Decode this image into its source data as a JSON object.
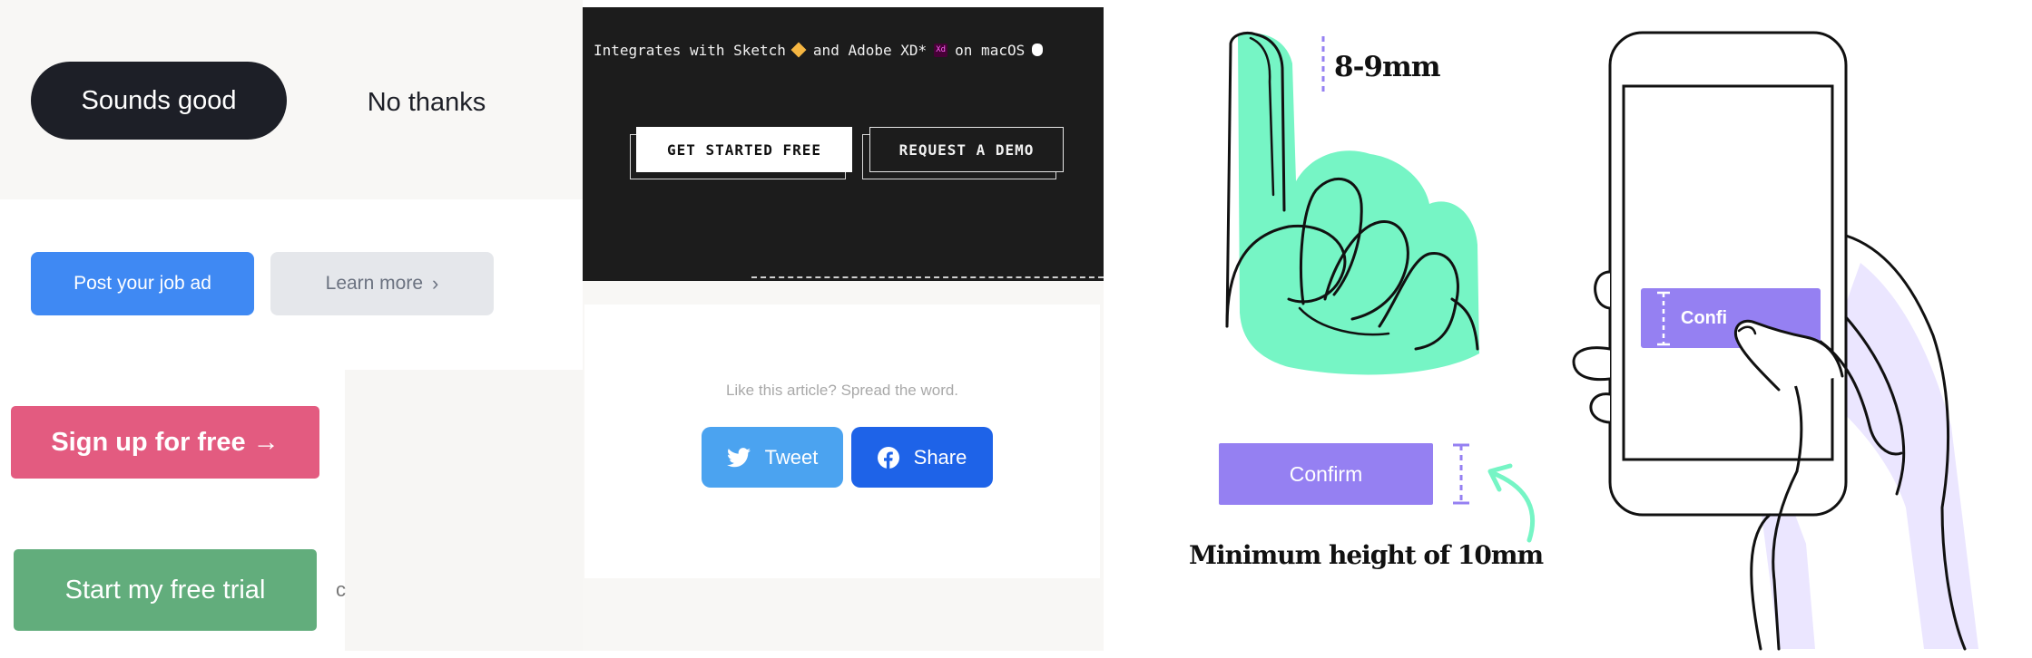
{
  "cta_sample_a": {
    "primary_label": "Sounds good",
    "secondary_label": "No thanks"
  },
  "cta_sample_b": {
    "primary_label": "Post your job ad",
    "secondary_label": "Learn more",
    "secondary_chevron": "›"
  },
  "cta_sample_c": {
    "signup_label": "Sign up for free →",
    "trial_label": "Start my free trial",
    "truncated_text": "c"
  },
  "cta_sample_d": {
    "integrates_before": "Integrates with Sketch",
    "integrates_mid": "and Adobe XD*",
    "xd_badge": "Xd",
    "integrates_after": "on macOS",
    "get_started_label": "GET STARTED FREE",
    "request_demo_label": "REQUEST A DEMO"
  },
  "cta_sample_e": {
    "spread_text": "Like this article? Spread the word.",
    "tweet_label": "Tweet",
    "share_label": "Share"
  },
  "illustration": {
    "finger_size_label": "8-9mm",
    "confirm_label": "Confirm",
    "min_height_label": "Minimum height of 10mm",
    "phone_button_label": "Confi"
  },
  "colors": {
    "dark_button": "#1d1f27",
    "blue_button": "#3f89f3",
    "pink_button": "#e35b80",
    "green_button": "#62ad7c",
    "twitter_blue": "#4ba3f0",
    "facebook_blue": "#1e63e8",
    "confirm_purple": "#9580f2",
    "finger_green": "#76f5c5",
    "hand_lavender": "#ebe6ff"
  },
  "icons": [
    "chevron-right-icon",
    "gem-icon",
    "adobe-xd-icon",
    "apple-icon",
    "twitter-icon",
    "facebook-icon"
  ]
}
